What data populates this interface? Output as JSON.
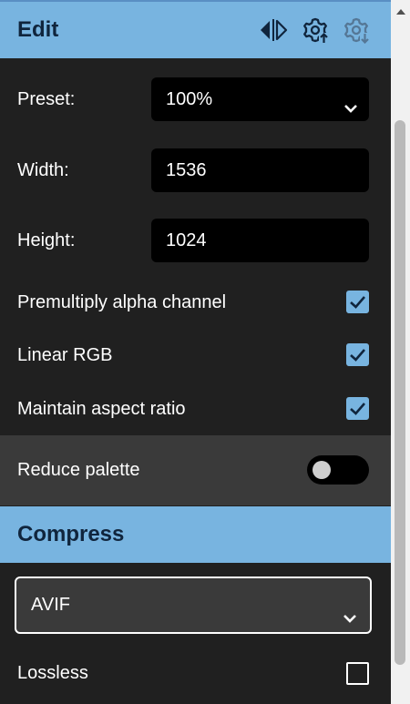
{
  "edit": {
    "title": "Edit",
    "preset_label": "Preset:",
    "preset_value": "100%",
    "width_label": "Width:",
    "width_value": "1536",
    "height_label": "Height:",
    "height_value": "1024",
    "options": [
      {
        "label": "Premultiply alpha channel",
        "checked": true
      },
      {
        "label": "Linear RGB",
        "checked": true
      },
      {
        "label": "Maintain aspect ratio",
        "checked": true
      }
    ],
    "reduce_palette": {
      "label": "Reduce palette",
      "on": false
    }
  },
  "compress": {
    "title": "Compress",
    "format": "AVIF",
    "lossless": {
      "label": "Lossless",
      "checked": false
    }
  },
  "icons": [
    "swap-icon",
    "settings-upload-icon",
    "settings-download-icon",
    "chevron-down-icon",
    "check-icon",
    "scroll-up-arrow-icon"
  ],
  "colors": {
    "header": "#78b4e0",
    "panel": "#202020",
    "accent": "#78b4e0"
  }
}
